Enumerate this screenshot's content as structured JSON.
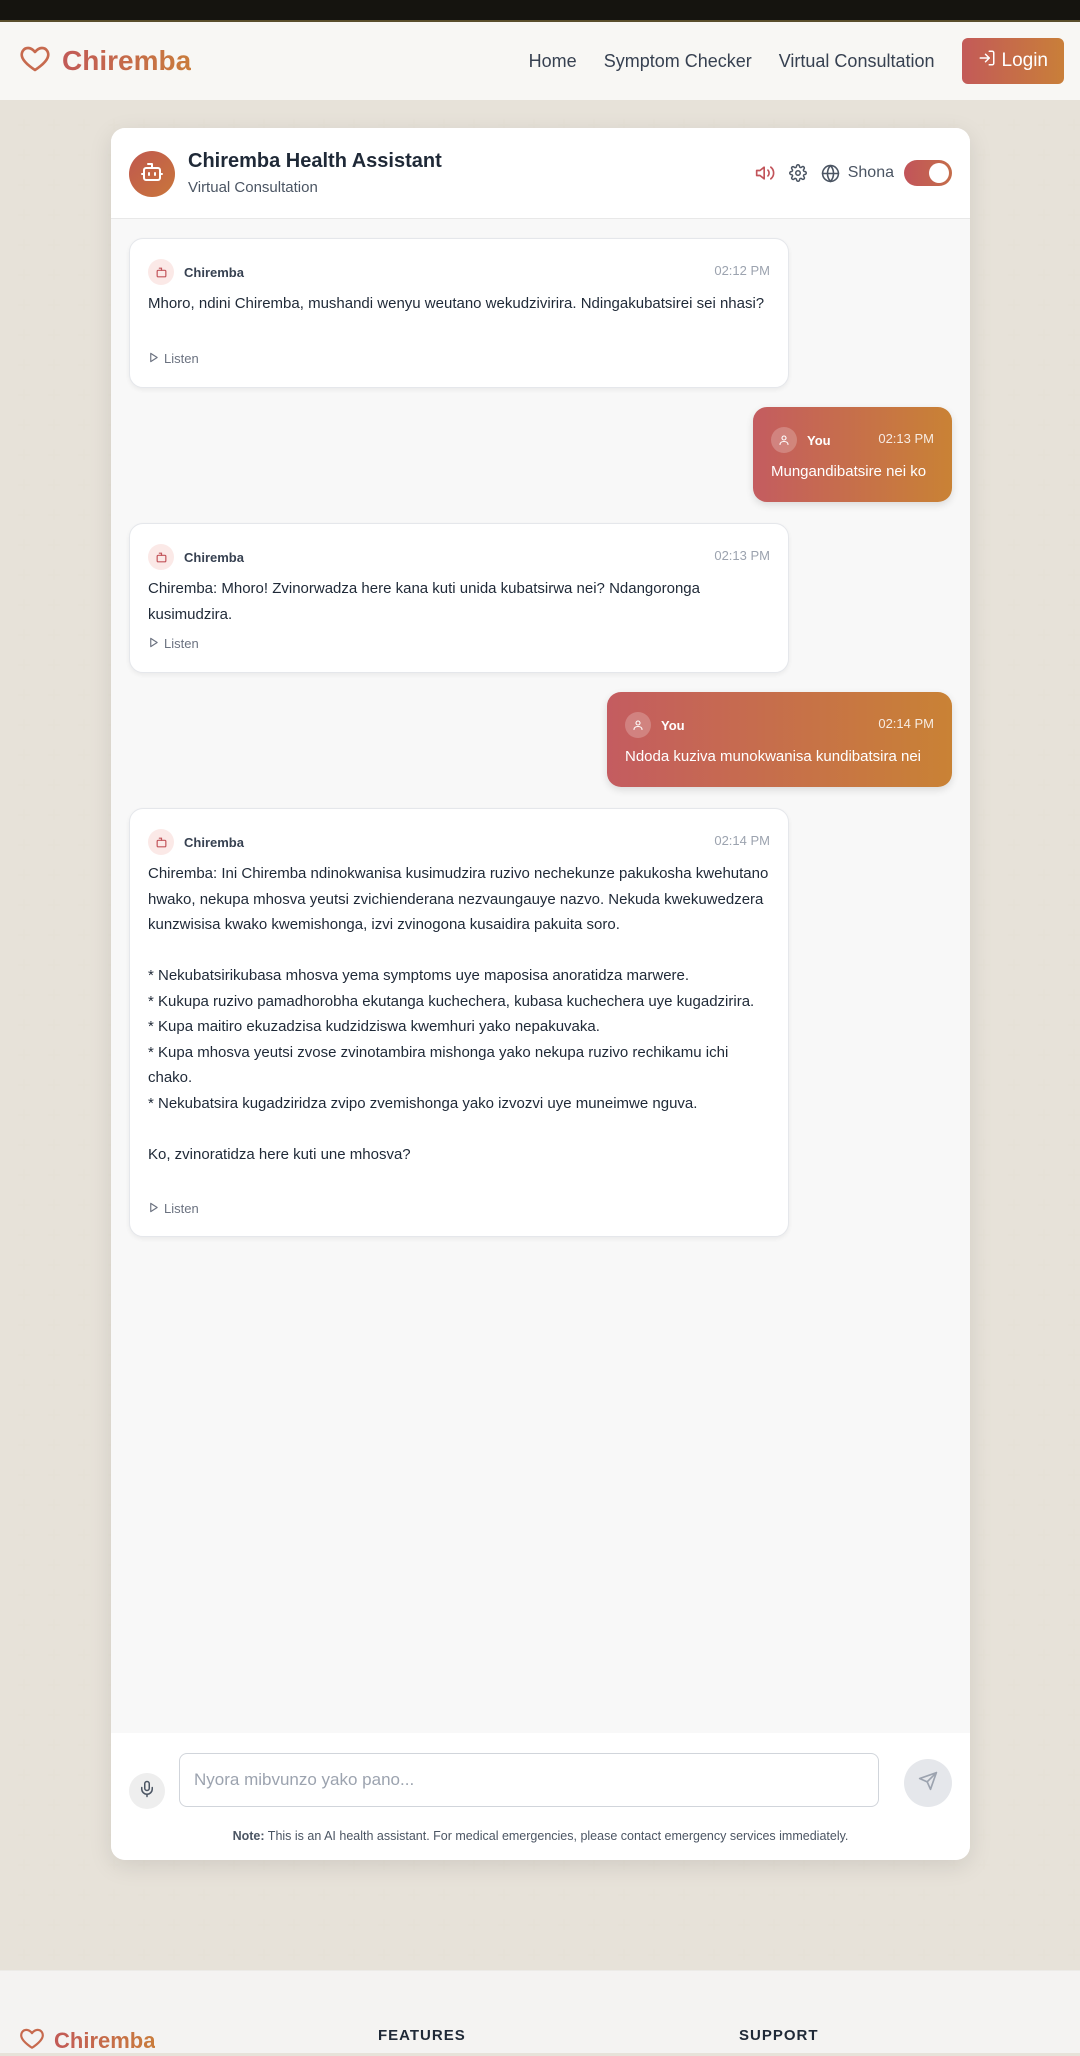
{
  "nav": {
    "brand": "Chiremba",
    "links": [
      "Home",
      "Symptom Checker",
      "Virtual Consultation"
    ],
    "login": "Login"
  },
  "chat": {
    "title": "Chiremba Health Assistant",
    "subtitle": "Virtual Consultation",
    "language": "Shona",
    "language_toggle_on": true,
    "listen_label": "Listen",
    "messages": [
      {
        "role": "bot",
        "sender": "Chiremba",
        "time": "02:12 PM",
        "text": "Mhoro, ndini Chiremba, mushandi wenyu weutano wekudzivirira. Ndingakubatsirei sei nhasi?"
      },
      {
        "role": "user",
        "sender": "You",
        "time": "02:13 PM",
        "text": "Mungandibatsire nei ko"
      },
      {
        "role": "bot",
        "sender": "Chiremba",
        "time": "02:13 PM",
        "text": "Chiremba: Mhoro! Zvinorwadza here kana kuti unida kubatsirwa nei? Ndangoronga kusimudzira."
      },
      {
        "role": "user",
        "sender": "You",
        "time": "02:14 PM",
        "text": "Ndoda kuziva munokwanisa kundibatsira nei"
      },
      {
        "role": "bot",
        "sender": "Chiremba",
        "time": "02:14 PM",
        "text": "Chiremba: Ini Chiremba ndinokwanisa kusimudzira ruzivo nechekunze pakukosha kwehutano hwako, nekupa mhosva yeutsi zvichienderana nezvaungauye nazvo. Nekuda kwekuwedzera kunzwisisa kwako kwemishonga, izvi zvinogona kusaidira pakuita soro.\n\n* Nekubatsirikubasa mhosva yema symptoms uye maposisa anoratidza marwere.\n* Kukupa ruzivo pamadhorobha ekutanga kuchechera, kubasa kuchechera uye kugadzirira.\n* Kupa maitiro ekuzadzisa kudzidziswa kwemhuri yako nepakuvaka.\n* Kupa mhosva yeutsi zvose zvinotambira mishonga yako nekupa ruzivo rechikamu ichi chako.\n* Nekubatsira kugadziridza zvipo zvemishonga yako izvozvi uye muneimwe nguva.\n\nKo, zvinoratidza here kuti une mhosva?"
      }
    ],
    "input_placeholder": "Nyora mibvunzo yako pano...",
    "input_value": "",
    "note_label": "Note:",
    "note_text": " This is an AI health assistant. For medical emergencies, please contact emergency services immediately."
  },
  "footer": {
    "brand": "Chiremba",
    "columns": [
      "FEATURES",
      "SUPPORT"
    ]
  },
  "colors": {
    "accent_start": "#c45c60",
    "accent_end": "#c98235",
    "page_bg": "#f7f5f1"
  }
}
